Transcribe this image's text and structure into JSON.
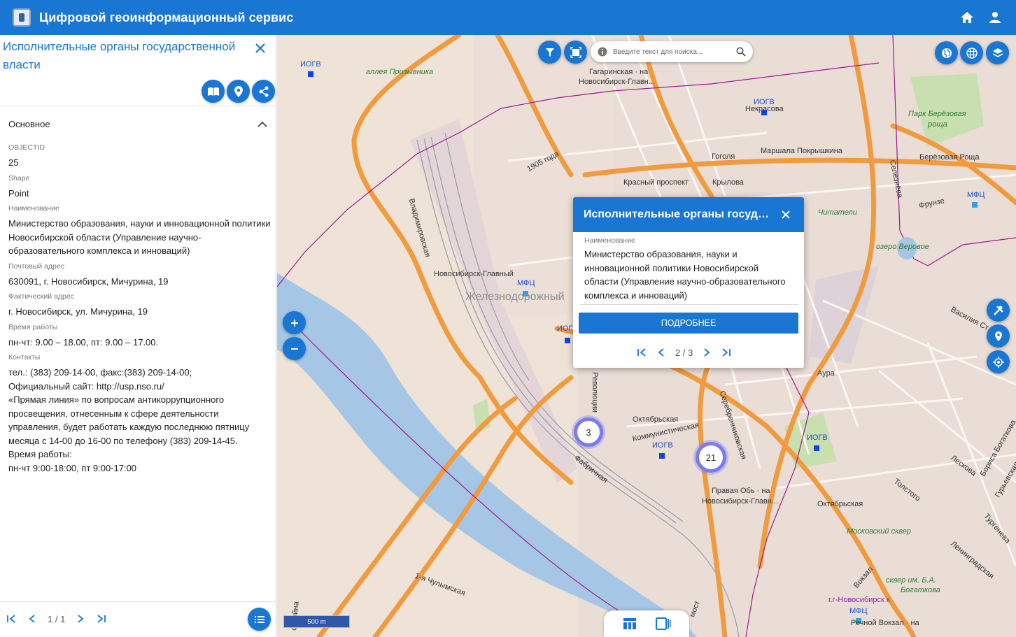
{
  "app": {
    "title": "Цифровой геоинформационный сервис"
  },
  "panel": {
    "title": "Исполнительные органы государственной власти",
    "section": "Основное",
    "fields": [
      {
        "label": "OBJECTID",
        "value": "25"
      },
      {
        "label": "Shape",
        "value": "Point"
      },
      {
        "label": "Наименование",
        "value": "Министерство образования, науки и инновационной политики Новосибирской области (Управление научно-образовательного комплекса и инноваций)"
      },
      {
        "label": "Почтовый адрес",
        "value": "630091, г. Новосибирск, Мичурина, 19"
      },
      {
        "label": "Фактический адрес",
        "value": "г. Новосибирск, ул. Мичурина, 19"
      },
      {
        "label": "Время работы",
        "value": "пн-чт: 9.00 – 18.00, пт: 9.00 – 17.00."
      },
      {
        "label": "Контакты",
        "value": "тел.: (383) 209-14-00, факс:(383) 209-14-00;\nОфициальный сайт: http://usp.nso.ru/\n«Прямая линия» по вопросам антикоррупционного просвещения, отнесенным к сфере деятельности управления, будет работать каждую последнюю пятницу месяца с 14-00 до 16-00 по телефону (383) 209-14-45.\nВремя работы:\nпн-чт 9:00-18:00, пт 9:00-17:00"
      }
    ],
    "pager": "1 / 1"
  },
  "search": {
    "placeholder": "Введите текст для поиска..."
  },
  "popup": {
    "title": "Исполнительные органы государственной власти",
    "label": "Наименование",
    "value": "Министерство образования, науки и инновационной политики Новосибирской области (Управление научно-образовательного комплекса и инноваций)",
    "button": "ПОДРОБНЕЕ",
    "pager": "2 / 3"
  },
  "clusters": [
    "3",
    "21"
  ],
  "scale": "500 m",
  "map_labels": {
    "iogv": "ИОГВ",
    "mfc": "МФЦ",
    "alleya": "аллея Призывника",
    "gagarinskaya": "Гагаринская · на",
    "novosib_glavn": "Новосибирск-Главн...",
    "nekrasova": "Некрасова",
    "park_berez": "Парк Берёзовая",
    "roshcha": "роща",
    "pokryshkina": "Маршала Покрышкина",
    "gogolya": "Гоголя",
    "berez_roshcha": "Берёзовая Роща",
    "ulitsa_1905": "1905 года",
    "krasny": "Красный проспект",
    "krylova": "Крылова",
    "frunze": "Фрунзе",
    "chitateli": "Читатели",
    "ozero": "озеро Веровое",
    "vladimirovskaya": "Владимировская",
    "novosib_glavny": "Новосибирск-Главный",
    "zheleznodorozhny": "Железнодорожный",
    "oktyabrskaya_ul": "Октябрьская",
    "kommunisticheskaya": "Коммунистическая",
    "serebrennikovskaya": "Серебренниковская",
    "fabrichnaya": "Фабричная",
    "revolyutsii": "Революции",
    "pravaya_ob": "Правая Обь · на",
    "oktyabrskaya": "Октябрьская",
    "moskovsky": "Московский сквер",
    "chulymskaya": "1-я Чулымская",
    "skver": "сквер им. Б.А.",
    "bogatkova": "Богаткова",
    "gorod": "г.г-Новосибирск к",
    "rechnoy": "Речной Вокзал · на",
    "aura": "Аура",
    "selezneva": "Селезнёва",
    "leskova": "Лескова",
    "tolstogo": "Толстого",
    "leningradskaya": "Ленинградская",
    "turgeneva": "Тургенева",
    "vasiliya": "Василия Ст",
    "borisa": "Бориса Богаткова",
    "guryevskaya": "Гурьевская",
    "vokzal": "Вокзал",
    "most": "мост",
    "ossiyna": "оссийна"
  },
  "colors": {
    "primary": "#1976d2",
    "cluster": "#7b7bf0",
    "road": "#f19a3e",
    "water": "#a6c6e6"
  }
}
